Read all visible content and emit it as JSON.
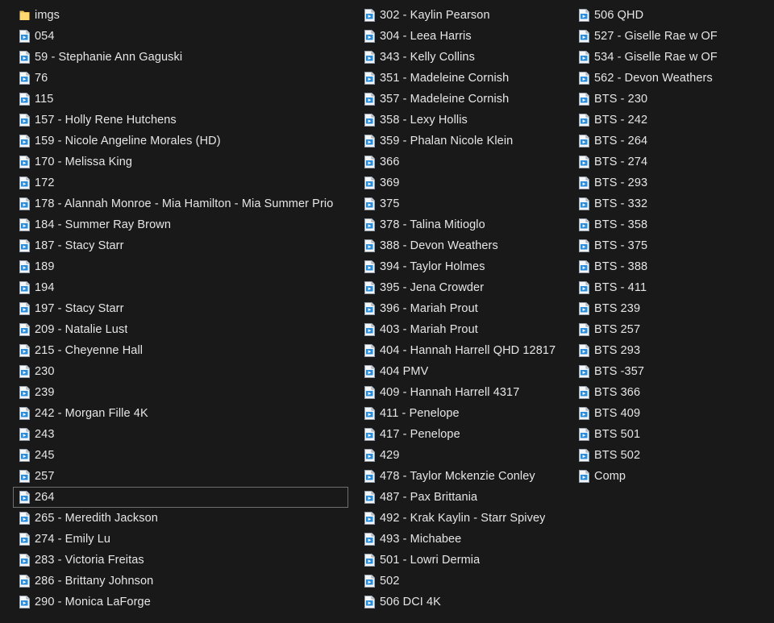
{
  "explorer": {
    "columns": [
      [
        {
          "name": "imgs",
          "icon": "folder-icon"
        },
        {
          "name": "054",
          "icon": "video-file-icon"
        },
        {
          "name": "59 - Stephanie Ann Gaguski",
          "icon": "video-file-icon"
        },
        {
          "name": "76",
          "icon": "video-file-icon"
        },
        {
          "name": "115",
          "icon": "video-file-icon"
        },
        {
          "name": "157 - Holly Rene Hutchens",
          "icon": "video-file-icon"
        },
        {
          "name": "159 - Nicole Angeline Morales (HD)",
          "icon": "video-file-icon"
        },
        {
          "name": "170 - Melissa King",
          "icon": "video-file-icon"
        },
        {
          "name": "172",
          "icon": "video-file-icon"
        },
        {
          "name": "178 - Alannah Monroe - Mia Hamilton - Mia Summer Prio",
          "icon": "video-file-icon"
        },
        {
          "name": "184 - Summer Ray Brown",
          "icon": "video-file-icon"
        },
        {
          "name": "187 - Stacy Starr",
          "icon": "video-file-icon"
        },
        {
          "name": "189",
          "icon": "video-file-icon"
        },
        {
          "name": "194",
          "icon": "video-file-icon"
        },
        {
          "name": "197 - Stacy Starr",
          "icon": "video-file-icon"
        },
        {
          "name": "209 - Natalie Lust",
          "icon": "video-file-icon"
        },
        {
          "name": "215 - Cheyenne Hall",
          "icon": "video-file-icon"
        },
        {
          "name": "230",
          "icon": "video-file-icon"
        },
        {
          "name": "239",
          "icon": "video-file-icon"
        },
        {
          "name": "242 - Morgan Fille 4K",
          "icon": "video-file-icon"
        },
        {
          "name": "243",
          "icon": "video-file-icon"
        },
        {
          "name": "245",
          "icon": "video-file-icon"
        },
        {
          "name": "257",
          "icon": "video-file-icon"
        },
        {
          "name": "264",
          "icon": "video-file-icon",
          "selected": true
        },
        {
          "name": "265 - Meredith Jackson",
          "icon": "video-file-icon"
        },
        {
          "name": "274 - Emily Lu",
          "icon": "video-file-icon"
        },
        {
          "name": "283 - Victoria Freitas",
          "icon": "video-file-icon"
        },
        {
          "name": "286 - Brittany Johnson",
          "icon": "video-file-icon"
        },
        {
          "name": "290 - Monica LaForge",
          "icon": "video-file-icon"
        }
      ],
      [
        {
          "name": "302 - Kaylin Pearson",
          "icon": "video-file-icon"
        },
        {
          "name": "304 - Leea Harris",
          "icon": "video-file-icon"
        },
        {
          "name": "343 - Kelly Collins",
          "icon": "video-file-icon"
        },
        {
          "name": "351 - Madeleine Cornish",
          "icon": "video-file-icon"
        },
        {
          "name": "357 - Madeleine Cornish",
          "icon": "video-file-icon"
        },
        {
          "name": "358 - Lexy Hollis",
          "icon": "video-file-icon"
        },
        {
          "name": "359 - Phalan Nicole Klein",
          "icon": "video-file-icon"
        },
        {
          "name": "366",
          "icon": "video-file-icon"
        },
        {
          "name": "369",
          "icon": "video-file-icon"
        },
        {
          "name": "375",
          "icon": "video-file-icon"
        },
        {
          "name": "378 - Talina Mitioglo",
          "icon": "video-file-icon"
        },
        {
          "name": "388 - Devon Weathers",
          "icon": "video-file-icon"
        },
        {
          "name": "394 - Taylor Holmes",
          "icon": "video-file-icon"
        },
        {
          "name": "395 - Jena Crowder",
          "icon": "video-file-icon"
        },
        {
          "name": "396 - Mariah Prout",
          "icon": "video-file-icon"
        },
        {
          "name": "403 - Mariah Prout",
          "icon": "video-file-icon"
        },
        {
          "name": "404 - Hannah Harrell QHD 12817",
          "icon": "video-file-icon"
        },
        {
          "name": "404 PMV",
          "icon": "video-file-icon"
        },
        {
          "name": "409 - Hannah Harrell 4317",
          "icon": "video-file-icon"
        },
        {
          "name": "411 - Penelope",
          "icon": "video-file-icon"
        },
        {
          "name": "417 - Penelope",
          "icon": "video-file-icon"
        },
        {
          "name": "429",
          "icon": "video-file-icon"
        },
        {
          "name": "478 - Taylor Mckenzie Conley",
          "icon": "video-file-icon"
        },
        {
          "name": "487 - Pax Brittania",
          "icon": "video-file-icon"
        },
        {
          "name": "492 - Krak Kaylin - Starr Spivey",
          "icon": "video-file-icon"
        },
        {
          "name": "493 - Michabee",
          "icon": "video-file-icon"
        },
        {
          "name": "501 - Lowri Dermia",
          "icon": "video-file-icon"
        },
        {
          "name": "502",
          "icon": "video-file-icon"
        },
        {
          "name": "506 DCI 4K",
          "icon": "video-file-icon"
        }
      ],
      [
        {
          "name": "506 QHD",
          "icon": "video-file-icon"
        },
        {
          "name": "527 - Giselle Rae w OF",
          "icon": "video-file-icon"
        },
        {
          "name": "534 - Giselle Rae w OF",
          "icon": "video-file-icon"
        },
        {
          "name": "562 -  Devon Weathers",
          "icon": "video-file-icon"
        },
        {
          "name": "BTS - 230",
          "icon": "video-file-icon"
        },
        {
          "name": "BTS - 242",
          "icon": "video-file-icon"
        },
        {
          "name": "BTS - 264",
          "icon": "video-file-icon"
        },
        {
          "name": "BTS - 274",
          "icon": "video-file-icon"
        },
        {
          "name": "BTS - 293",
          "icon": "video-file-icon"
        },
        {
          "name": "BTS - 332",
          "icon": "video-file-icon"
        },
        {
          "name": "BTS - 358",
          "icon": "video-file-icon"
        },
        {
          "name": "BTS - 375",
          "icon": "video-file-icon"
        },
        {
          "name": "BTS - 388",
          "icon": "video-file-icon"
        },
        {
          "name": "BTS - 411",
          "icon": "video-file-icon"
        },
        {
          "name": "BTS 239",
          "icon": "video-file-icon"
        },
        {
          "name": "BTS 257",
          "icon": "video-file-icon"
        },
        {
          "name": "BTS 293",
          "icon": "video-file-icon"
        },
        {
          "name": "BTS -357",
          "icon": "video-file-icon"
        },
        {
          "name": "BTS 366",
          "icon": "video-file-icon"
        },
        {
          "name": "BTS 409",
          "icon": "video-file-icon"
        },
        {
          "name": "BTS 501",
          "icon": "video-file-icon"
        },
        {
          "name": "BTS 502",
          "icon": "video-file-icon"
        },
        {
          "name": "Comp",
          "icon": "video-file-icon"
        }
      ]
    ]
  },
  "colors": {
    "background": "#191919",
    "text": "#e6e6e6",
    "selection_border": "#6f6f6f",
    "folder": "#f0c65a",
    "file_icon_accent": "#2a8bd8"
  }
}
